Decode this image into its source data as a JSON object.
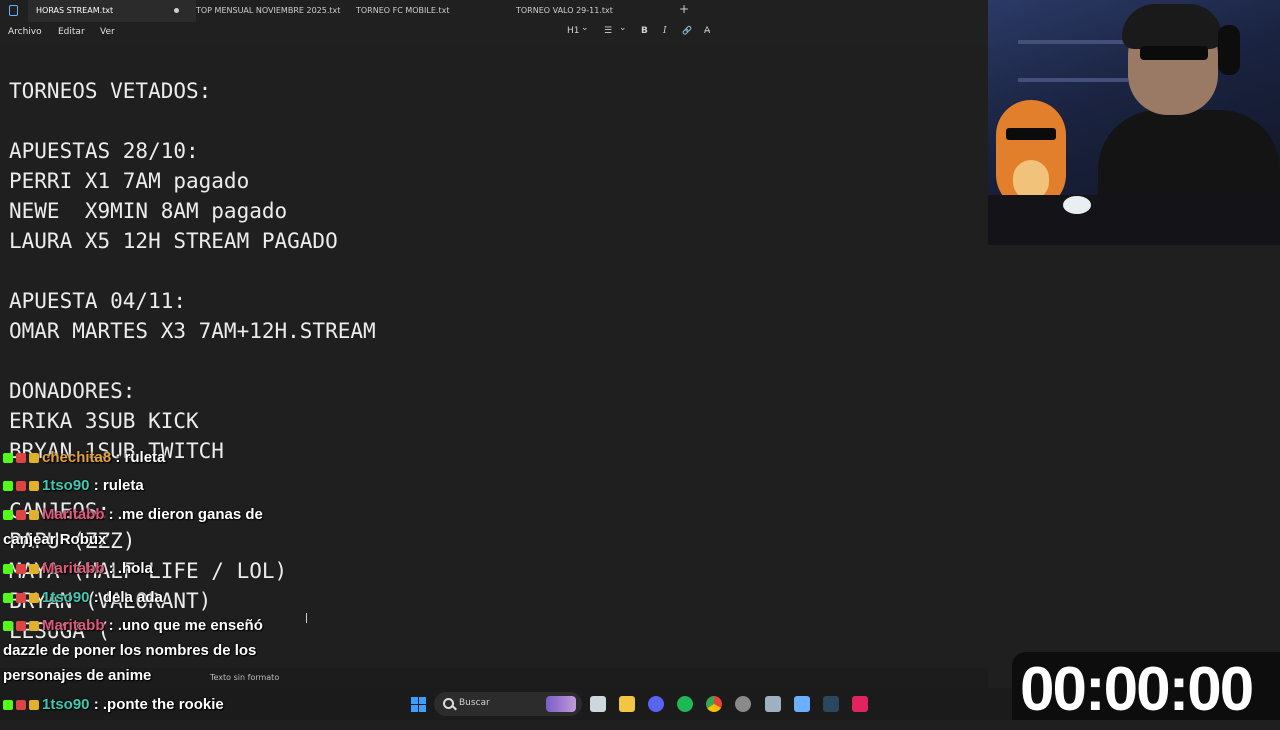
{
  "tabs": [
    {
      "label": "HORAS STREAM.txt",
      "active": true
    },
    {
      "label": "TOP MENSUAL NOVIEMBRE 2025.txt",
      "active": false
    },
    {
      "label": "TORNEO FC MOBILE.txt",
      "active": false
    },
    {
      "label": "TORNEO VALO 29-11.txt",
      "active": false
    }
  ],
  "new_tab": "+",
  "menu": {
    "file": "Archivo",
    "edit": "Editar",
    "view": "Ver"
  },
  "format": {
    "heading": "H1",
    "heading_caret": "⌄",
    "list": "☰",
    "list_caret": "⌄",
    "bold": "B",
    "italic": "I",
    "link": "🔗",
    "clear": "A̶"
  },
  "document": {
    "lines": [
      "TORNEOS VETADOS:",
      "",
      "APUESTAS 28/10:",
      "PERRI X1 7AM pagado",
      "NEWE  X9MIN 8AM pagado",
      "LAURA X5 12H STREAM PAGADO",
      "",
      "APUESTA 04/11:",
      "OMAR MARTES X3 7AM+12H.STREAM",
      "",
      "DONADORES:",
      "ERIKA 3SUB KICK",
      "BRYAN 1SUB TWITCH",
      "",
      "CANJEOS:",
      "PAPU (ZZZ)",
      "MAYA (HALF LIFE / LOL)",
      "BRYAN (VALORANT)",
      "LESUGA ("
    ]
  },
  "status": {
    "format": "Texto sin formato"
  },
  "taskbar": {
    "search_label": "Buscar"
  },
  "chat": [
    {
      "user": "chechita8",
      "user_color": "#e6a23c",
      "message": ": ruleta"
    },
    {
      "user": "1tso90",
      "user_color": "#3ec9b0",
      "message": ": ruleta"
    },
    {
      "user": "Maritabb",
      "user_color": "#e0577a",
      "message": ": .me dieron ganas de",
      "cont": "canjear Robux"
    },
    {
      "user": "Maritabb",
      "user_color": "#e0577a",
      "message": ": .hola"
    },
    {
      "user": "1tso90",
      "user_color": "#3ec9b0",
      "message": ": dela ada"
    },
    {
      "user": "Maritabb",
      "user_color": "#e0577a",
      "message": ": .uno que me enseñó",
      "cont": "dazzle de poner los nombres de los",
      "cont2": "personajes de anime"
    },
    {
      "user": "1tso90",
      "user_color": "#3ec9b0",
      "message": ": .ponte the rookie"
    }
  ],
  "timer": "00:00:00",
  "colors": {
    "accent": "#3aa0ff",
    "kick_badge": "#53fc18",
    "editor_bg": "#1f1f1f"
  }
}
